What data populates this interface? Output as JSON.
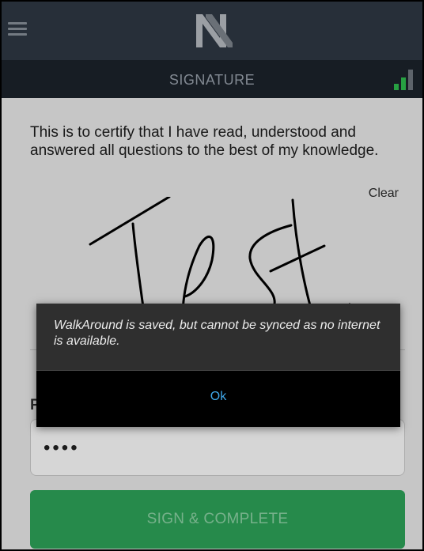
{
  "header": {
    "menu_icon": "hamburger-menu-icon",
    "logo_icon": "brand-n-logo"
  },
  "titlebar": {
    "title": "SIGNATURE",
    "signal_icon": "signal-strength-icon",
    "signal_color": "#2fbf4f"
  },
  "content": {
    "certification_text": "This is to certify that I have read, understood and answered all questions to the best of my knowledge.",
    "clear_label": "Clear",
    "signature_text": "Test",
    "password_label": "P",
    "password_value": "••••",
    "sign_button_label": "SIGN & COMPLETE",
    "sign_button_color": "#2ea55a"
  },
  "dialog": {
    "message": "WalkAround is saved, but cannot be synced as no internet is available.",
    "ok_label": "Ok",
    "ok_color": "#3fa7e8"
  }
}
